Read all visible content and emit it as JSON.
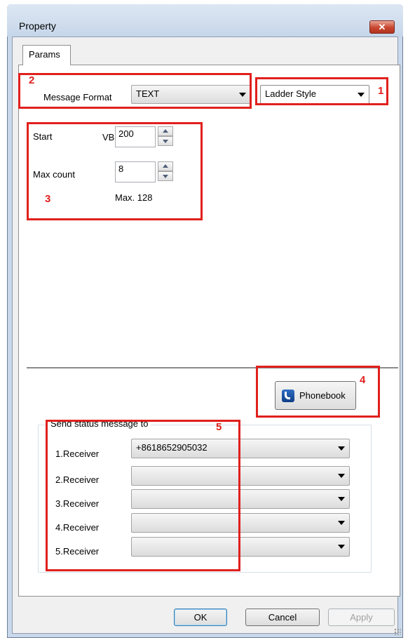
{
  "window": {
    "title": "Property",
    "close_icon": "close-icon",
    "close_glyph": "✕"
  },
  "tabs": [
    {
      "label": "Params",
      "active": true
    }
  ],
  "params": {
    "message_format_label": "Message Format",
    "message_format_value": "TEXT",
    "style_value": "Ladder Style",
    "start_label": "Start",
    "start_prefix": "VB",
    "start_value": "200",
    "max_count_label": "Max count",
    "max_count_value": "8",
    "max_note": "Max. 128"
  },
  "phonebook": {
    "label": "Phonebook",
    "icon": "phone-icon"
  },
  "send_status": {
    "title": "Send status message to",
    "receivers": [
      {
        "label": "1.Receiver",
        "value": "+8618652905032"
      },
      {
        "label": "2.Receiver",
        "value": ""
      },
      {
        "label": "3.Receiver",
        "value": ""
      },
      {
        "label": "4.Receiver",
        "value": ""
      },
      {
        "label": "5.Receiver",
        "value": ""
      }
    ]
  },
  "annotations": {
    "n1": "1",
    "n2": "2",
    "n3": "3",
    "n4": "4",
    "n5": "5",
    "color": "#e0201d"
  },
  "footer": {
    "ok_label": "OK",
    "cancel_label": "Cancel",
    "apply_label": "Apply"
  }
}
